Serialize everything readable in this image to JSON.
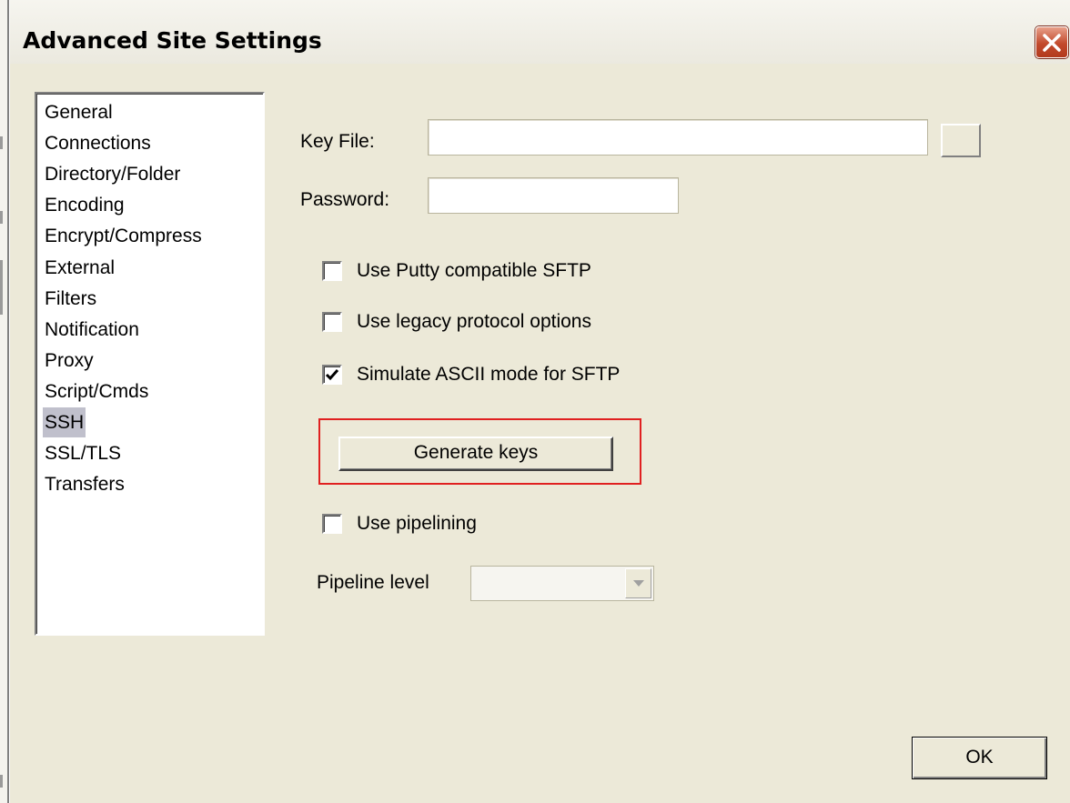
{
  "window": {
    "title": "Advanced Site Settings"
  },
  "sidebar": {
    "selected": "SSH",
    "items": [
      {
        "label": "General"
      },
      {
        "label": "Connections"
      },
      {
        "label": "Directory/Folder"
      },
      {
        "label": "Encoding"
      },
      {
        "label": "Encrypt/Compress"
      },
      {
        "label": "External"
      },
      {
        "label": "Filters"
      },
      {
        "label": "Notification"
      },
      {
        "label": "Proxy"
      },
      {
        "label": "Script/Cmds"
      },
      {
        "label": "SSH"
      },
      {
        "label": "SSL/TLS"
      },
      {
        "label": "Transfers"
      }
    ]
  },
  "ssh": {
    "key_file": {
      "label": "Key File:",
      "value": ""
    },
    "password": {
      "label": "Password:",
      "value": ""
    },
    "options": [
      {
        "label": "Use Putty compatible SFTP",
        "checked": false
      },
      {
        "label": "Use legacy protocol options",
        "checked": false
      },
      {
        "label": "Simulate ASCII mode for SFTP",
        "checked": true
      }
    ],
    "generate_keys_label": "Generate keys",
    "pipelining": {
      "label": "Use pipelining",
      "checked": false
    },
    "pipeline_level": {
      "label": "Pipeline level",
      "value": ""
    }
  },
  "footer": {
    "ok_label": "OK"
  },
  "colors": {
    "dialog_bg": "#ece9d8",
    "selection_bg": "#c0c0cc",
    "highlight_border": "#e02020",
    "close_button": "#c24a2c"
  }
}
